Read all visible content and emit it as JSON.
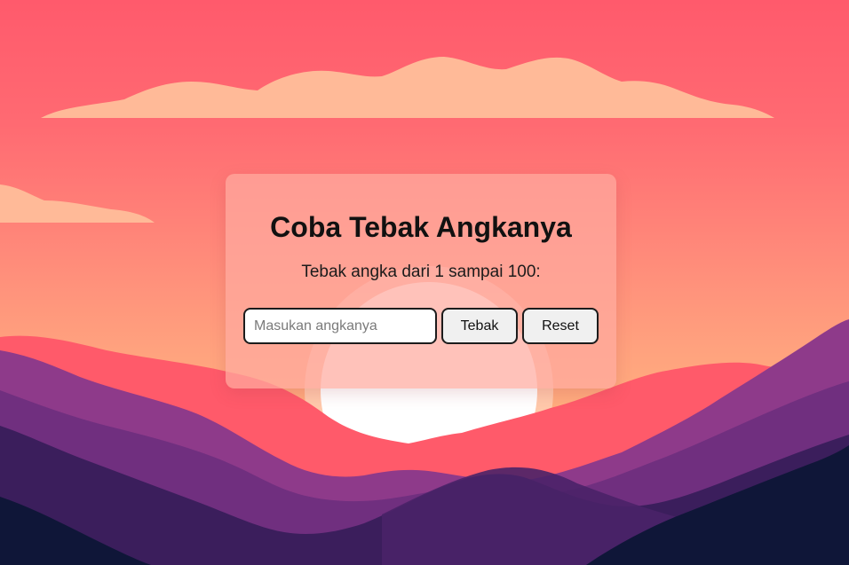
{
  "game": {
    "title": "Coba Tebak Angkanya",
    "instruction": "Tebak angka dari 1 sampai 100:",
    "input_placeholder": "Masukan angkanya",
    "input_value": "",
    "guess_button_label": "Tebak",
    "reset_button_label": "Reset"
  },
  "colors": {
    "sky_top": "#ff5a6c",
    "sky_bottom": "#ffb07e",
    "cloud": "#ffba98",
    "sun": "#ffffff",
    "mountain_red": "#ff5a6a",
    "mountain_purple": "#8e3a8a",
    "mountain_dark": "#3b1e5c",
    "mountain_navy": "#0f1638"
  }
}
